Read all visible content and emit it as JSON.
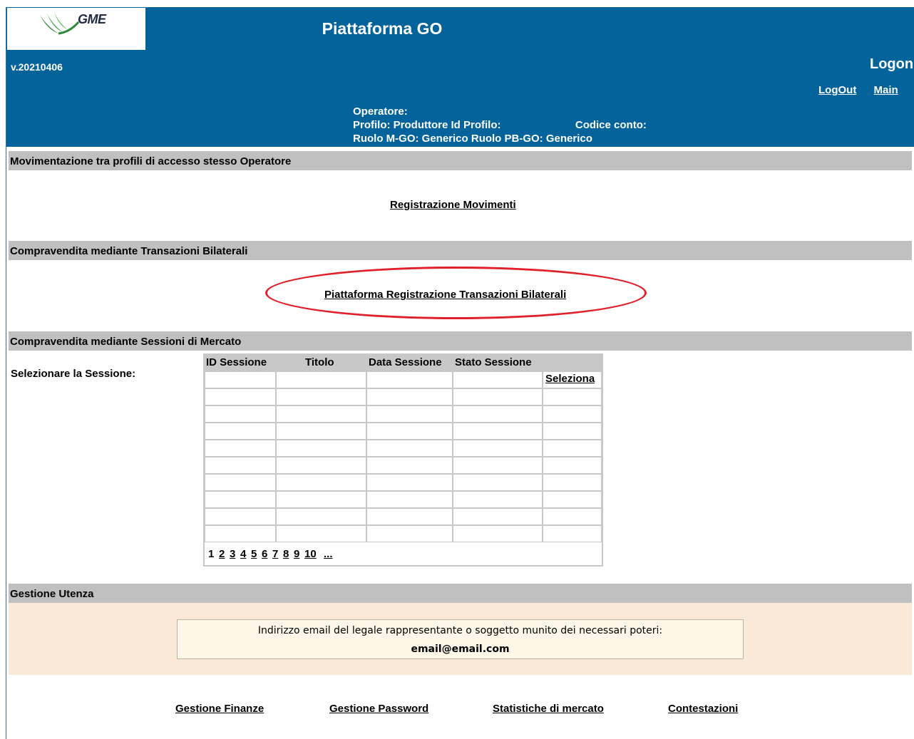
{
  "header": {
    "logo_text": "GME",
    "title": "Piattaforma GO",
    "version": "v.20210406",
    "logon": "Logon",
    "links": {
      "logout": "LogOut",
      "main": "Main"
    },
    "operator": {
      "operatore_label": "Operatore:",
      "profilo_label": "Profilo:",
      "profilo_value": "Produttore",
      "id_profilo_label": "Id Profilo:",
      "codice_conto_label": "Codice conto:",
      "ruolo_mgo_label": "Ruolo M-GO:",
      "ruolo_mgo_value": "Generico",
      "ruolo_pbgo_label": "Ruolo PB-GO:",
      "ruolo_pbgo_value": "Generico"
    },
    "colors": {
      "header_bg": "#04639b",
      "section_bar": "#c0c0c0",
      "highlight": "#e0202a"
    }
  },
  "sections": {
    "movimentazione": {
      "title": "Movimentazione tra profili di accesso stesso Operatore",
      "link": "Registrazione Movimenti"
    },
    "bilaterali": {
      "title": "Compravendita mediante Transazioni Bilaterali",
      "link": "Piattaforma Registrazione Transazioni Bilaterali"
    },
    "sessioni": {
      "title": "Compravendita mediante Sessioni di Mercato",
      "select_label": "Selezionare la Sessione:",
      "columns": [
        "ID Sessione",
        "Titolo",
        "Data Sessione",
        "Stato Sessione"
      ],
      "select_link": "Seleziona",
      "pages": [
        "1",
        "2",
        "3",
        "4",
        "5",
        "6",
        "7",
        "8",
        "9",
        "10",
        "..."
      ],
      "current_page": "1"
    },
    "utenza": {
      "title": "Gestione Utenza",
      "email_label": "Indirizzo email del legale rappresentante o soggetto munito dei necessari poteri:",
      "email_value": "email@email.com"
    }
  },
  "footer_links": {
    "finanze": "Gestione Finanze",
    "password": "Gestione Password",
    "statistiche": "Statistiche di mercato",
    "contestazioni": "Contestazioni"
  }
}
